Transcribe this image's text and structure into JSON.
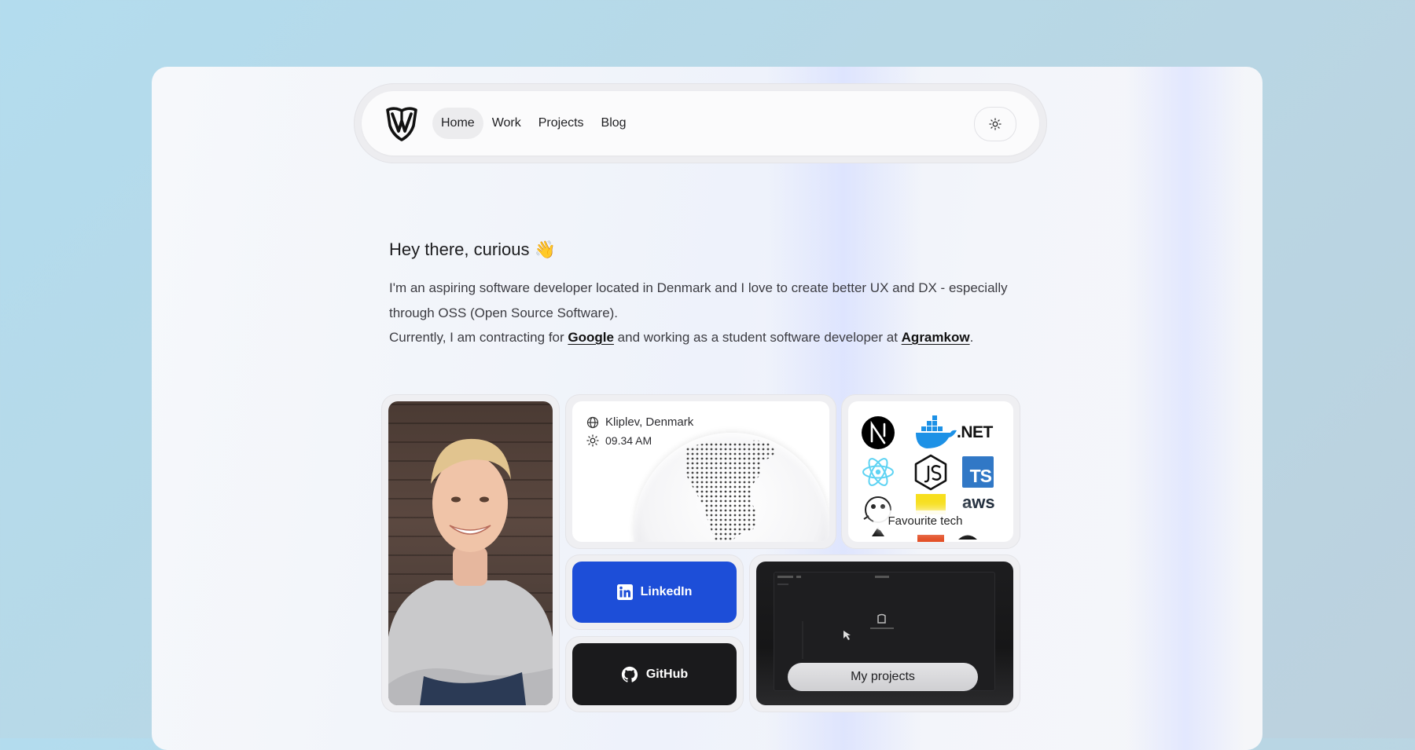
{
  "nav": {
    "links": [
      {
        "label": "Home",
        "active": true
      },
      {
        "label": "Work",
        "active": false
      },
      {
        "label": "Projects",
        "active": false
      },
      {
        "label": "Blog",
        "active": false
      }
    ],
    "logo_icon": "shield-logo-icon",
    "theme_icon": "sun-icon"
  },
  "hero": {
    "greeting": "Hey there, curious 👋",
    "bio_line1": "I'm an aspiring software developer located in Denmark and I love to create better UX and DX - especially through OSS (Open Source Software).",
    "bio_line2_pre": "Currently, I am contracting for ",
    "bio_link1": "Google",
    "bio_line2_mid": " and working as a student software developer at ",
    "bio_link2": "Agramkow",
    "bio_line2_end": "."
  },
  "location": {
    "place": "Kliplev, Denmark",
    "time": "09.34 AM"
  },
  "tech": {
    "label": "Favourite tech",
    "items": [
      ".NET",
      "TS",
      "aws"
    ]
  },
  "social": {
    "linkedin": "LinkedIn",
    "github": "GitHub"
  },
  "projects": {
    "label": "My projects"
  },
  "colors": {
    "linkedin_blue": "#1d4ed8",
    "github_black": "#1a1a1c",
    "accent_text": "#111111"
  }
}
